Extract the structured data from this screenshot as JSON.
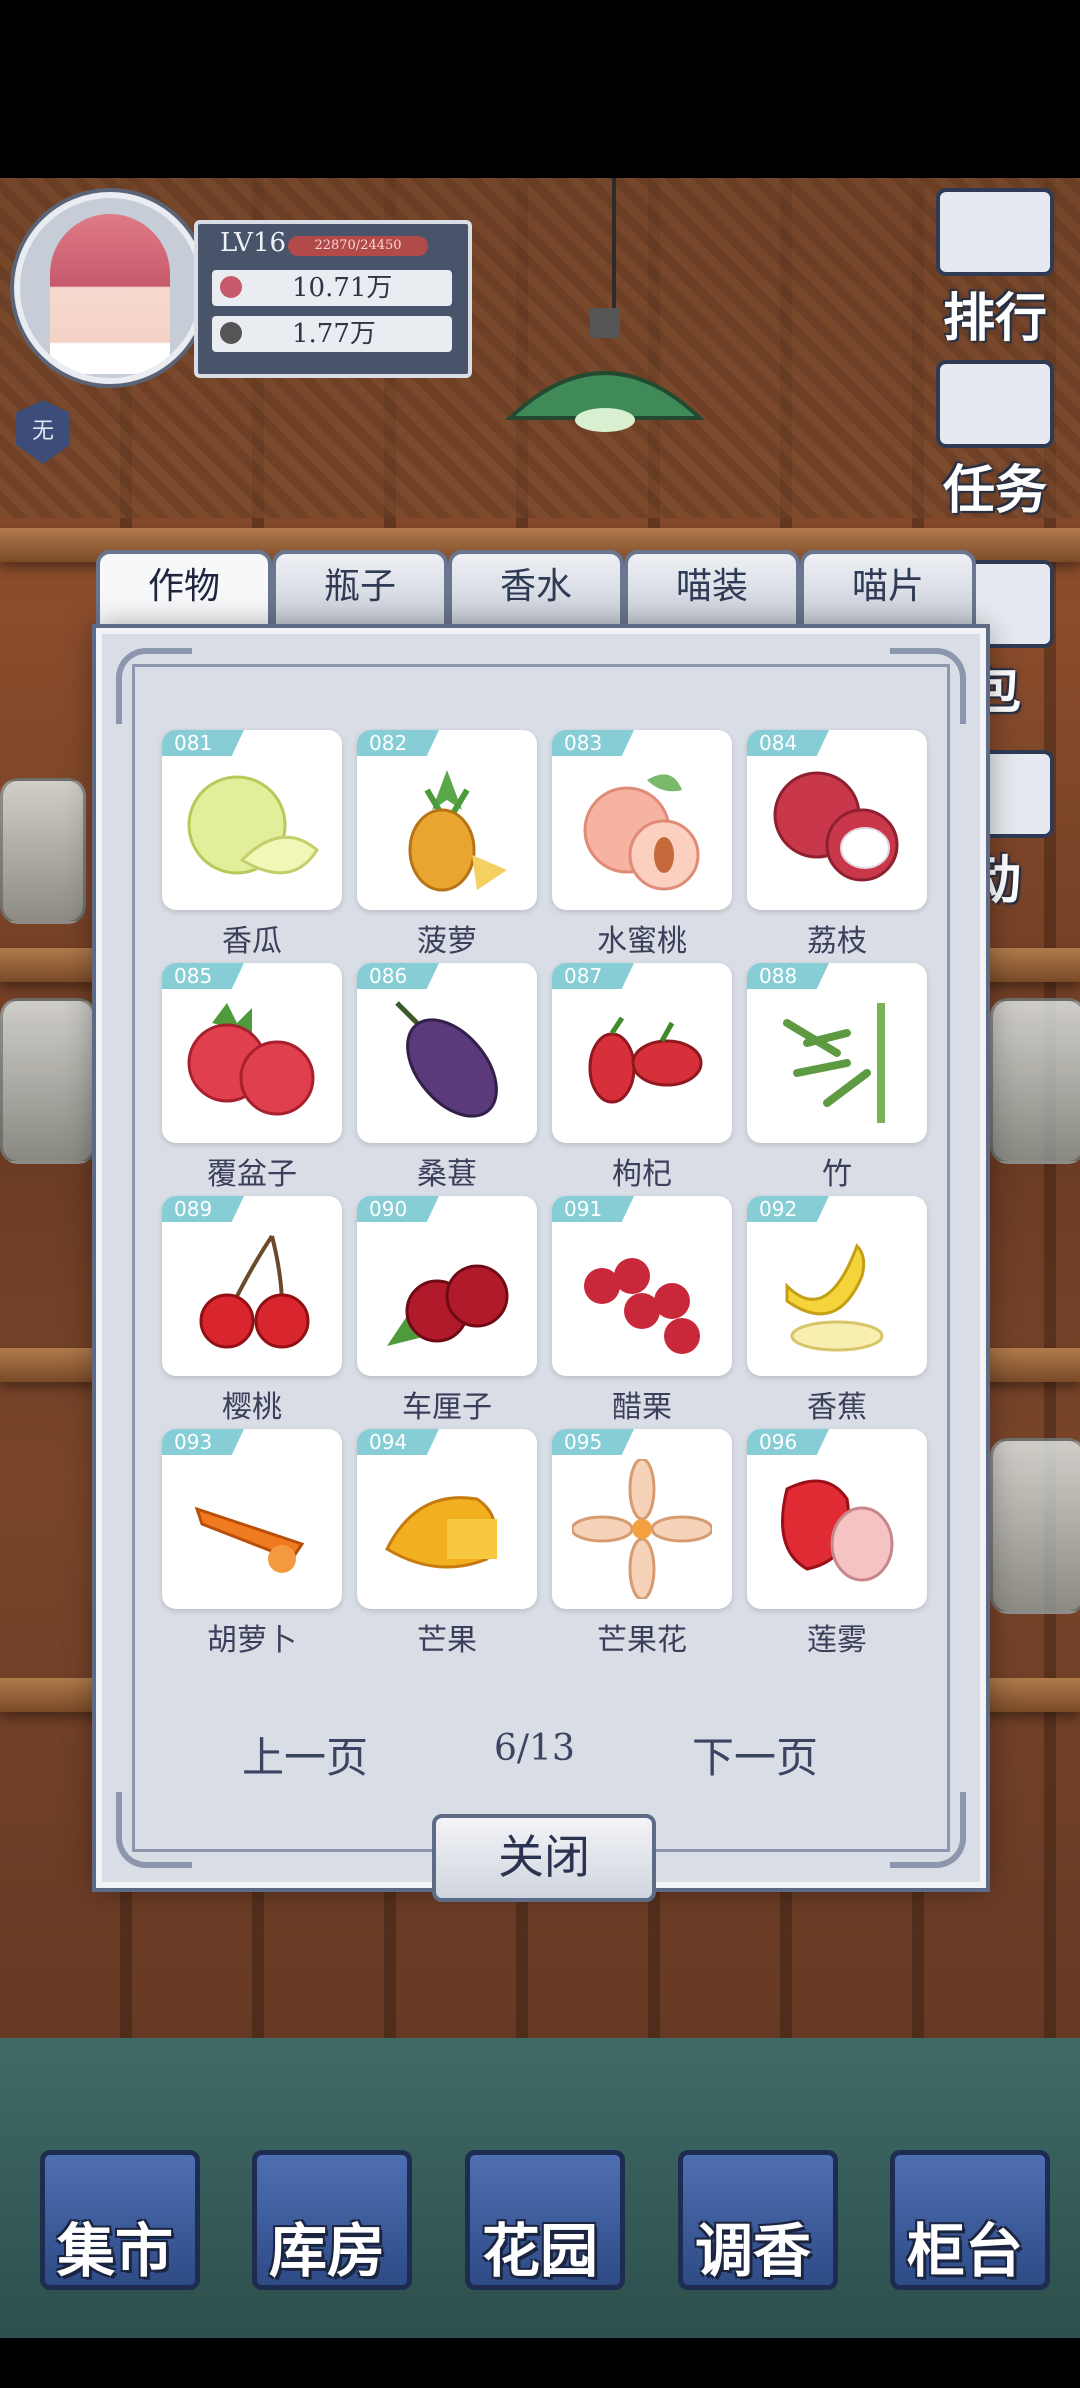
{
  "player": {
    "level": "LV16",
    "xp": "22870/24450",
    "currency_1": "10.71万",
    "currency_2": "1.77万",
    "title_badge": "无"
  },
  "side_menu": [
    {
      "label": "排行",
      "icon": "ranking-icon"
    },
    {
      "label": "任务",
      "icon": "task-scroll-icon"
    },
    {
      "label": "包",
      "icon": "bag-icon"
    },
    {
      "label": "动",
      "icon": "activity-icon"
    }
  ],
  "collection": {
    "tabs": [
      "作物",
      "瓶子",
      "香水",
      "喵装",
      "喵片"
    ],
    "active_tab": 0,
    "items": [
      {
        "no": "081",
        "name": "香瓜",
        "icon": "melon-icon"
      },
      {
        "no": "082",
        "name": "菠萝",
        "icon": "pineapple-icon"
      },
      {
        "no": "083",
        "name": "水蜜桃",
        "icon": "peach-icon"
      },
      {
        "no": "084",
        "name": "荔枝",
        "icon": "lychee-icon"
      },
      {
        "no": "085",
        "name": "覆盆子",
        "icon": "raspberry-icon"
      },
      {
        "no": "086",
        "name": "桑葚",
        "icon": "mulberry-icon"
      },
      {
        "no": "087",
        "name": "枸杞",
        "icon": "goji-icon"
      },
      {
        "no": "088",
        "name": "竹",
        "icon": "bamboo-icon"
      },
      {
        "no": "089",
        "name": "樱桃",
        "icon": "cherry-icon"
      },
      {
        "no": "090",
        "name": "车厘子",
        "icon": "dark-cherry-icon"
      },
      {
        "no": "091",
        "name": "醋栗",
        "icon": "currant-icon"
      },
      {
        "no": "092",
        "name": "香蕉",
        "icon": "banana-icon"
      },
      {
        "no": "093",
        "name": "胡萝卜",
        "icon": "carrot-icon"
      },
      {
        "no": "094",
        "name": "芒果",
        "icon": "mango-icon"
      },
      {
        "no": "095",
        "name": "芒果花",
        "icon": "mango-flower-icon"
      },
      {
        "no": "096",
        "name": "莲雾",
        "icon": "wax-apple-icon"
      }
    ],
    "pager": {
      "prev": "上一页",
      "page": "6/13",
      "next": "下一页"
    },
    "close_label": "关闭"
  },
  "bottom_nav": [
    "集市",
    "库房",
    "花园",
    "调香",
    "柜台"
  ],
  "colors": {
    "accent": "#5d6b86",
    "tag": "#86cdd6",
    "nav": "#2e4b86"
  }
}
